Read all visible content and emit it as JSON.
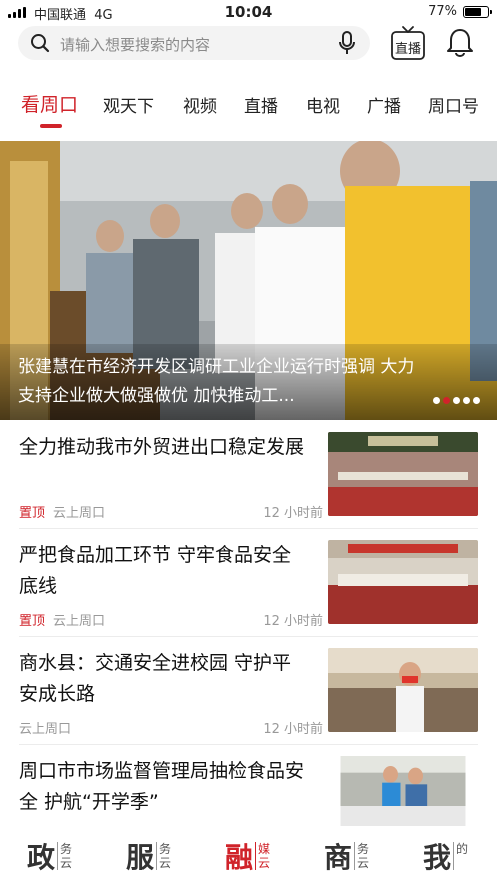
{
  "status_bar": {
    "carrier": "中国联通",
    "network": "4G",
    "time": "10:04",
    "battery_percent": "77%",
    "battery_level": 0.77
  },
  "search": {
    "placeholder": "请输入想要搜索的内容"
  },
  "header": {
    "live_label": "直播"
  },
  "tabs": [
    {
      "label": "看周口",
      "active": true
    },
    {
      "label": "观天下"
    },
    {
      "label": "视频"
    },
    {
      "label": "直播"
    },
    {
      "label": "电视"
    },
    {
      "label": "广播"
    },
    {
      "label": "周口号"
    }
  ],
  "hero": {
    "caption": "张建慧在市经济开发区调研工业企业运行时强调 大力支持企业做大做强做优 加快推动工...",
    "slide_count": 5,
    "active_slide": 2
  },
  "news": [
    {
      "title": "全力推动我市外贸进出口稳定发展",
      "pin": "置顶",
      "source": "云上周口",
      "time": "12 小时前"
    },
    {
      "title": "严把食品加工环节 守牢食品安全底线",
      "pin": "置顶",
      "source": "云上周口",
      "time": "12 小时前"
    },
    {
      "title": "商水县：交通安全进校园 守护平安成长路",
      "pin": "",
      "source": "云上周口",
      "time": "12 小时前"
    },
    {
      "title": "周口市市场监督管理局抽检食品安全 护航“开学季”",
      "pin": "",
      "source": "",
      "time": ""
    }
  ],
  "bottom_nav": [
    {
      "big": "政",
      "small": "务云"
    },
    {
      "big": "服",
      "small": "务云"
    },
    {
      "big": "融",
      "small": "媒云",
      "active": true
    },
    {
      "big": "商",
      "small": "务云"
    },
    {
      "big": "我",
      "small": "的"
    }
  ],
  "colors": {
    "accent": "#d0232a"
  }
}
